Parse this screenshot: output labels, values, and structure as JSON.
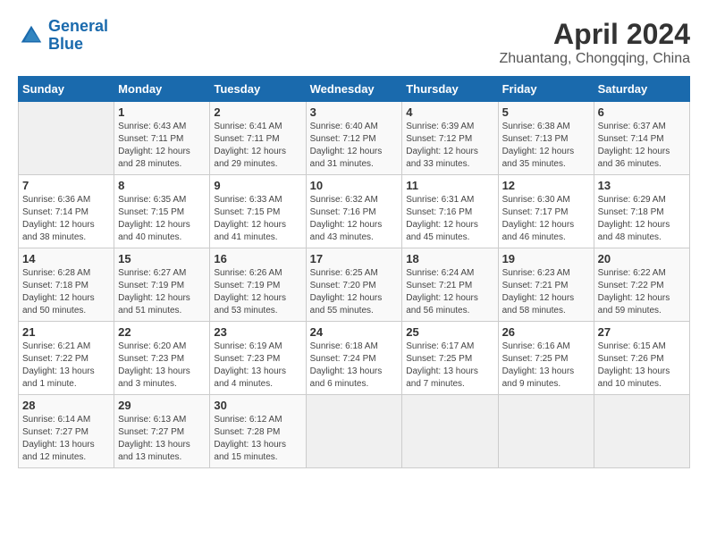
{
  "header": {
    "logo_line1": "General",
    "logo_line2": "Blue",
    "title": "April 2024",
    "subtitle": "Zhuantang, Chongqing, China"
  },
  "weekdays": [
    "Sunday",
    "Monday",
    "Tuesday",
    "Wednesday",
    "Thursday",
    "Friday",
    "Saturday"
  ],
  "weeks": [
    [
      {
        "day": "",
        "info": ""
      },
      {
        "day": "1",
        "info": "Sunrise: 6:43 AM\nSunset: 7:11 PM\nDaylight: 12 hours\nand 28 minutes."
      },
      {
        "day": "2",
        "info": "Sunrise: 6:41 AM\nSunset: 7:11 PM\nDaylight: 12 hours\nand 29 minutes."
      },
      {
        "day": "3",
        "info": "Sunrise: 6:40 AM\nSunset: 7:12 PM\nDaylight: 12 hours\nand 31 minutes."
      },
      {
        "day": "4",
        "info": "Sunrise: 6:39 AM\nSunset: 7:12 PM\nDaylight: 12 hours\nand 33 minutes."
      },
      {
        "day": "5",
        "info": "Sunrise: 6:38 AM\nSunset: 7:13 PM\nDaylight: 12 hours\nand 35 minutes."
      },
      {
        "day": "6",
        "info": "Sunrise: 6:37 AM\nSunset: 7:14 PM\nDaylight: 12 hours\nand 36 minutes."
      }
    ],
    [
      {
        "day": "7",
        "info": "Sunrise: 6:36 AM\nSunset: 7:14 PM\nDaylight: 12 hours\nand 38 minutes."
      },
      {
        "day": "8",
        "info": "Sunrise: 6:35 AM\nSunset: 7:15 PM\nDaylight: 12 hours\nand 40 minutes."
      },
      {
        "day": "9",
        "info": "Sunrise: 6:33 AM\nSunset: 7:15 PM\nDaylight: 12 hours\nand 41 minutes."
      },
      {
        "day": "10",
        "info": "Sunrise: 6:32 AM\nSunset: 7:16 PM\nDaylight: 12 hours\nand 43 minutes."
      },
      {
        "day": "11",
        "info": "Sunrise: 6:31 AM\nSunset: 7:16 PM\nDaylight: 12 hours\nand 45 minutes."
      },
      {
        "day": "12",
        "info": "Sunrise: 6:30 AM\nSunset: 7:17 PM\nDaylight: 12 hours\nand 46 minutes."
      },
      {
        "day": "13",
        "info": "Sunrise: 6:29 AM\nSunset: 7:18 PM\nDaylight: 12 hours\nand 48 minutes."
      }
    ],
    [
      {
        "day": "14",
        "info": "Sunrise: 6:28 AM\nSunset: 7:18 PM\nDaylight: 12 hours\nand 50 minutes."
      },
      {
        "day": "15",
        "info": "Sunrise: 6:27 AM\nSunset: 7:19 PM\nDaylight: 12 hours\nand 51 minutes."
      },
      {
        "day": "16",
        "info": "Sunrise: 6:26 AM\nSunset: 7:19 PM\nDaylight: 12 hours\nand 53 minutes."
      },
      {
        "day": "17",
        "info": "Sunrise: 6:25 AM\nSunset: 7:20 PM\nDaylight: 12 hours\nand 55 minutes."
      },
      {
        "day": "18",
        "info": "Sunrise: 6:24 AM\nSunset: 7:21 PM\nDaylight: 12 hours\nand 56 minutes."
      },
      {
        "day": "19",
        "info": "Sunrise: 6:23 AM\nSunset: 7:21 PM\nDaylight: 12 hours\nand 58 minutes."
      },
      {
        "day": "20",
        "info": "Sunrise: 6:22 AM\nSunset: 7:22 PM\nDaylight: 12 hours\nand 59 minutes."
      }
    ],
    [
      {
        "day": "21",
        "info": "Sunrise: 6:21 AM\nSunset: 7:22 PM\nDaylight: 13 hours\nand 1 minute."
      },
      {
        "day": "22",
        "info": "Sunrise: 6:20 AM\nSunset: 7:23 PM\nDaylight: 13 hours\nand 3 minutes."
      },
      {
        "day": "23",
        "info": "Sunrise: 6:19 AM\nSunset: 7:23 PM\nDaylight: 13 hours\nand 4 minutes."
      },
      {
        "day": "24",
        "info": "Sunrise: 6:18 AM\nSunset: 7:24 PM\nDaylight: 13 hours\nand 6 minutes."
      },
      {
        "day": "25",
        "info": "Sunrise: 6:17 AM\nSunset: 7:25 PM\nDaylight: 13 hours\nand 7 minutes."
      },
      {
        "day": "26",
        "info": "Sunrise: 6:16 AM\nSunset: 7:25 PM\nDaylight: 13 hours\nand 9 minutes."
      },
      {
        "day": "27",
        "info": "Sunrise: 6:15 AM\nSunset: 7:26 PM\nDaylight: 13 hours\nand 10 minutes."
      }
    ],
    [
      {
        "day": "28",
        "info": "Sunrise: 6:14 AM\nSunset: 7:27 PM\nDaylight: 13 hours\nand 12 minutes."
      },
      {
        "day": "29",
        "info": "Sunrise: 6:13 AM\nSunset: 7:27 PM\nDaylight: 13 hours\nand 13 minutes."
      },
      {
        "day": "30",
        "info": "Sunrise: 6:12 AM\nSunset: 7:28 PM\nDaylight: 13 hours\nand 15 minutes."
      },
      {
        "day": "",
        "info": ""
      },
      {
        "day": "",
        "info": ""
      },
      {
        "day": "",
        "info": ""
      },
      {
        "day": "",
        "info": ""
      }
    ]
  ]
}
